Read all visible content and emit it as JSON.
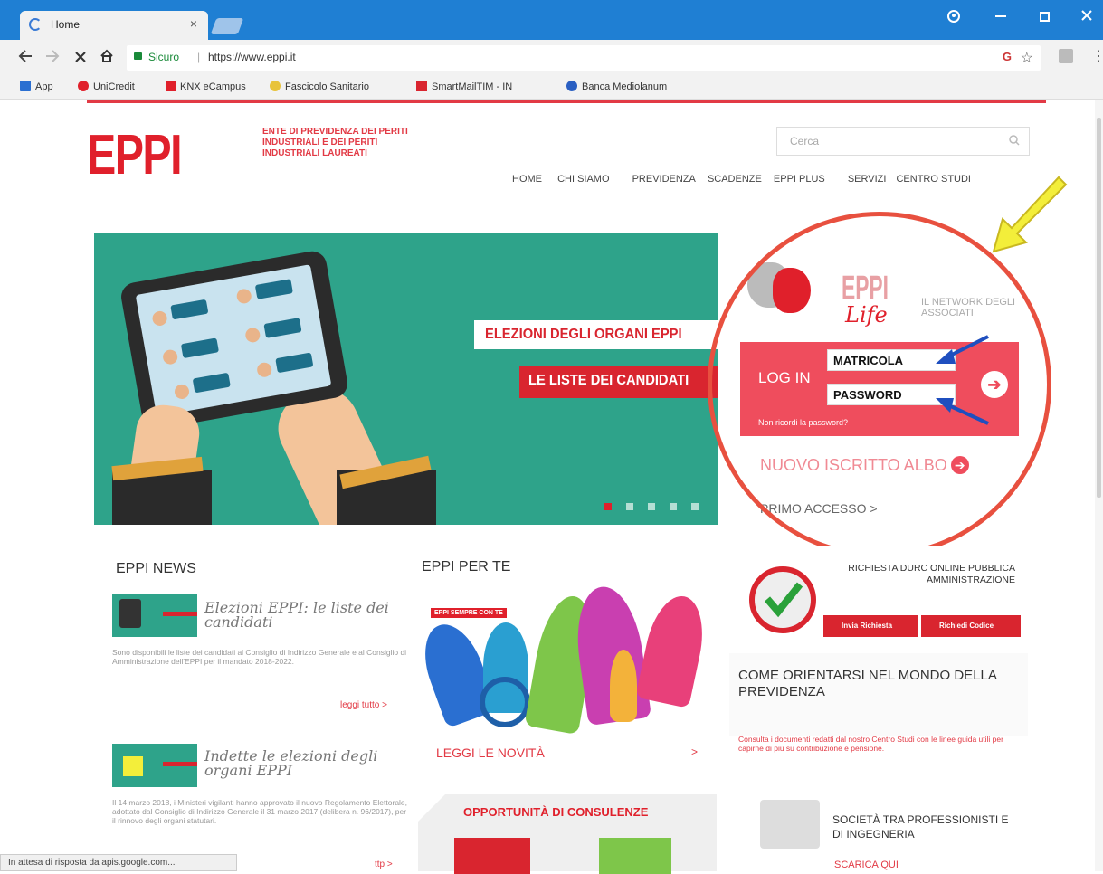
{
  "browser": {
    "tab_title": "Home",
    "close_glyph": "×",
    "secure_label": "Sicuro",
    "url": "https://www.eppi.it",
    "bookmarks": [
      "App",
      "UniCredit",
      "KNX eCampus",
      "Fascicolo Sanitario",
      "SmartMailTIM - IN",
      "Banca Mediolanum"
    ],
    "status_text": "In attesa di risposta da apis.google.com..."
  },
  "header": {
    "logo": "EPPI",
    "logo_text": "ENTE DI PREVIDENZA DEI PERITI INDUSTRIALI E DEI PERITI INDUSTRIALI LAUREATI",
    "search_placeholder": "Cerca",
    "nav": [
      "HOME",
      "CHI SIAMO",
      "PREVIDENZA",
      "SCADENZE",
      "EPPI PLUS",
      "SERVIZI",
      "CENTRO STUDI"
    ]
  },
  "hero": {
    "banner1": "ELEZIONI DEGLI ORGANI EPPI",
    "banner2": "LE LISTE DEI CANDIDATI",
    "slides": 5
  },
  "login": {
    "brand": "EPPI",
    "script": "Life",
    "network": "IL NETWORK DEGLI ASSOCIATI",
    "label": "LOG IN",
    "matricola": "MATRICOLA",
    "password": "PASSWORD",
    "forgot": "Non ricordi la password?",
    "nuovo": "NUOVO ISCRITTO ALBO",
    "primo": "PRIMO ACCESSO >"
  },
  "news": {
    "title": "EPPI NEWS",
    "items": [
      {
        "title": "Elezioni EPPI: le liste dei candidati",
        "text": "Sono disponibili le liste dei candidati al Consiglio di Indirizzo Generale e al Consiglio di Amministrazione dell'EPPI per il mandato 2018-2022.",
        "more": "leggi tutto >"
      },
      {
        "title": "Indette le elezioni degli organi EPPI",
        "text": "Il 14 marzo 2018, i Ministeri vigilanti hanno approvato il nuovo Regolamento Elettorale, adottato dal Consiglio di Indirizzo Generale il 31 marzo 2017 (delibera n. 96/2017), per il rinnovo degli organi statutari.",
        "more": "ttp >"
      }
    ]
  },
  "perte": {
    "title": "EPPI PER TE",
    "badge": "EPPI SEMPRE CON TE",
    "link": "LEGGI LE NOVITÀ",
    "link_arrow": ">",
    "opportunity": "OPPORTUNITÀ DI CONSULENZE"
  },
  "right": {
    "durc_title": "RICHIESTA DURC ONLINE PUBBLICA AMMINISTRAZIONE",
    "btn1": "Invia Richiesta",
    "btn2": "Richiedi Codice",
    "orient_title": "COME ORIENTARSI NEL MONDO DELLA PREVIDENZA",
    "orient_text": "Consulta i documenti redatti dal nostro Centro Studi con le linee guida utili per capirne di più su contribuzione e pensione.",
    "societa": "SOCIETÀ TRA PROFESSIONISTI E DI INGEGNERIA",
    "scarica": "SCARICA QUI"
  }
}
